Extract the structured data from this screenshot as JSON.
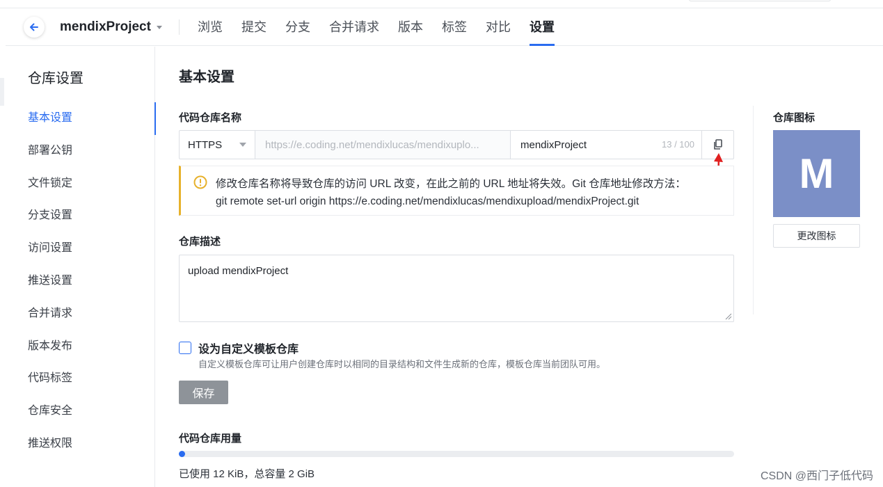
{
  "header": {
    "back_icon": "arrow-left-icon",
    "project_name": "mendixProject",
    "tabs": [
      {
        "label": "浏览"
      },
      {
        "label": "提交"
      },
      {
        "label": "分支"
      },
      {
        "label": "合并请求"
      },
      {
        "label": "版本"
      },
      {
        "label": "标签"
      },
      {
        "label": "对比"
      },
      {
        "label": "设置",
        "active": true
      }
    ]
  },
  "sidebar": {
    "title": "仓库设置",
    "items": [
      {
        "label": "基本设置",
        "active": true
      },
      {
        "label": "部署公钥"
      },
      {
        "label": "文件锁定"
      },
      {
        "label": "分支设置"
      },
      {
        "label": "访问设置"
      },
      {
        "label": "推送设置"
      },
      {
        "label": "合并请求"
      },
      {
        "label": "版本发布"
      },
      {
        "label": "代码标签"
      },
      {
        "label": "仓库安全"
      },
      {
        "label": "推送权限"
      }
    ]
  },
  "main": {
    "title": "基本设置",
    "repo_name_label": "代码仓库名称",
    "protocol": "HTTPS",
    "url_prefix": "https://e.coding.net/mendixlucas/mendixuplo...",
    "repo_name_value": "mendixProject",
    "counter": "13 / 100",
    "warning_line1": "修改仓库名称将导致仓库的访问 URL 改变，在此之前的 URL 地址将失效。Git 仓库地址修改方法：",
    "warning_line2": "git remote set-url origin https://e.coding.net/mendixlucas/mendixupload/mendixProject.git",
    "desc_label": "仓库描述",
    "desc_value": "upload mendixProject",
    "template_label": "设为自定义模板仓库",
    "template_hint": "自定义模板仓库可让用户创建仓库时以相同的目录结构和文件生成新的仓库，模板仓库当前团队可用。",
    "save_label": "保存",
    "usage_label": "代码仓库用量",
    "usage_fraction": 0.006,
    "usage_text": "已使用 12 KiB，总容量 2 GiB"
  },
  "right": {
    "icon_label": "仓库图标",
    "avatar_letter": "M",
    "avatar_color": "#7b8fc7",
    "change_icon_label": "更改图标"
  },
  "watermark": "CSDN @西门子低代码",
  "colors": {
    "accent": "#2a6cf0",
    "warning": "#e7b12b",
    "annotation_arrow": "#e02020"
  }
}
